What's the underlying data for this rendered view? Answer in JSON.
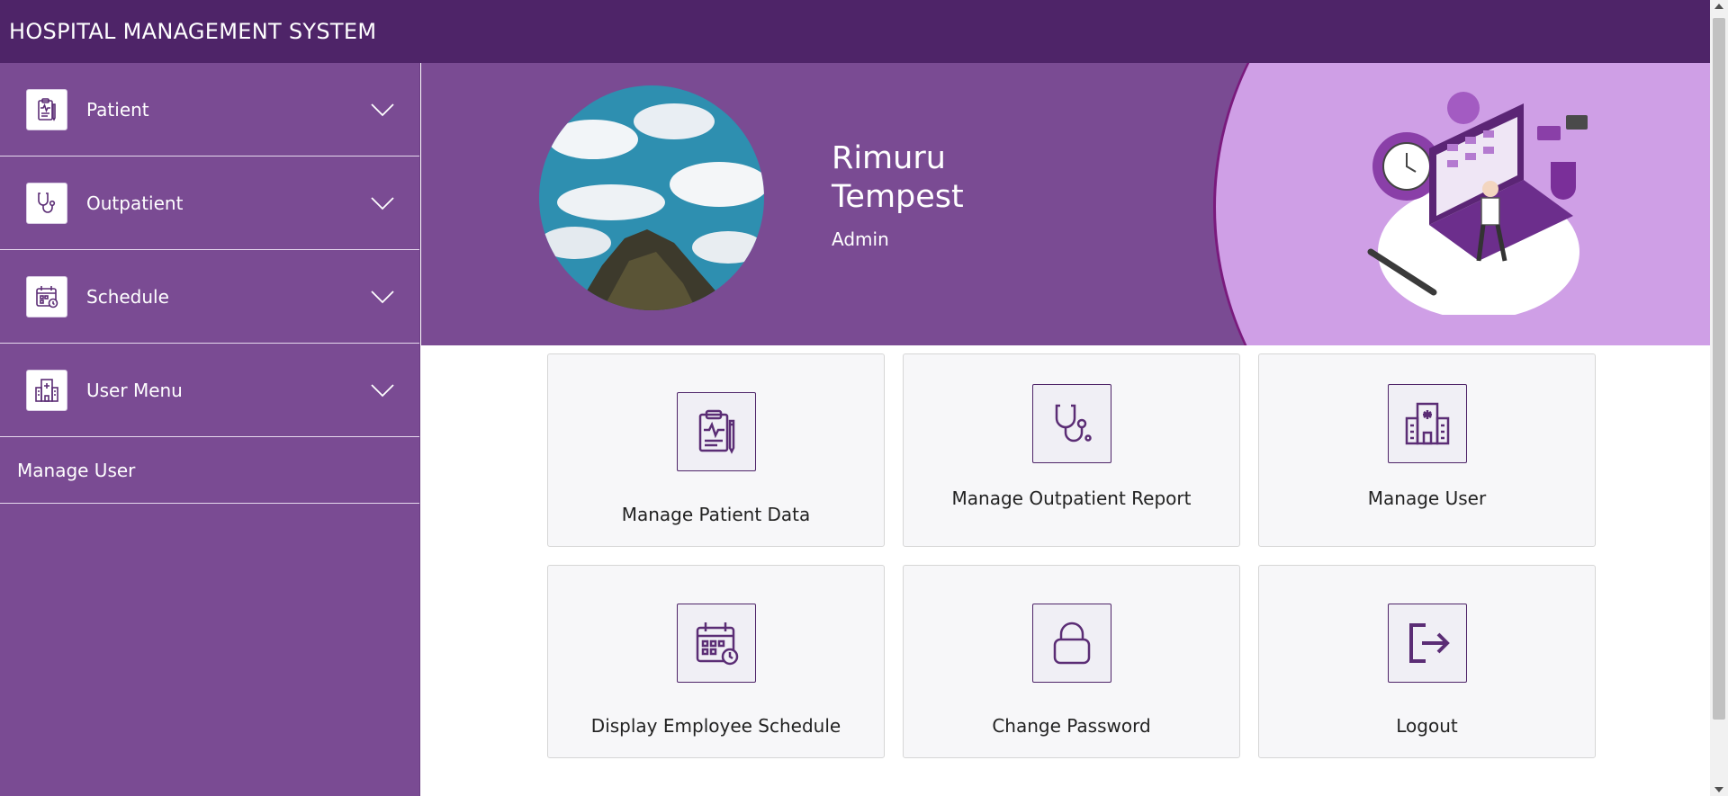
{
  "header": {
    "title": "HOSPITAL MANAGEMENT SYSTEM"
  },
  "sidebar": {
    "items": [
      {
        "label": "Patient",
        "icon": "clipboard-icon"
      },
      {
        "label": "Outpatient",
        "icon": "stethoscope-icon"
      },
      {
        "label": "Schedule",
        "icon": "calendar-icon"
      },
      {
        "label": "User Menu",
        "icon": "hospital-icon"
      }
    ],
    "link": "Manage User"
  },
  "profile": {
    "first_name": "Rimuru",
    "last_name": "Tempest",
    "role": "Admin"
  },
  "cards": [
    {
      "label": "Manage Patient Data",
      "icon": "clipboard-icon"
    },
    {
      "label": "Manage Outpatient Report",
      "icon": "stethoscope-icon"
    },
    {
      "label": "Manage User",
      "icon": "hospital-icon"
    },
    {
      "label": "Display Employee Schedule",
      "icon": "calendar-icon"
    },
    {
      "label": "Change Password",
      "icon": "lock-icon"
    },
    {
      "label": "Logout",
      "icon": "logout-icon"
    }
  ],
  "colors": {
    "topbar": "#4e2468",
    "sidebar": "#7a4b93",
    "accent_light": "#cf9fe6",
    "icon_stroke": "#5b2d75"
  }
}
